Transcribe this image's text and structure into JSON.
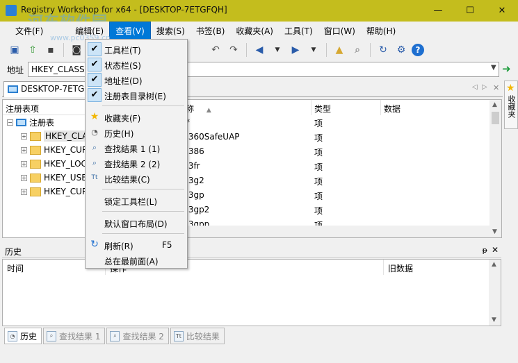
{
  "window": {
    "title": "Registry Workshop for x64 - [DESKTOP-7ETGFQH]",
    "minimize": "—",
    "maximize": "☐",
    "close": "✕",
    "watermark": "河东软件园",
    "watermark_url": "www.pc0359.cn"
  },
  "menu": [
    "文件(F)",
    "编辑(E)",
    "查看(V)",
    "搜索(S)",
    "书签(B)",
    "收藏夹(A)",
    "工具(T)",
    "窗口(W)",
    "帮助(H)"
  ],
  "address": {
    "label": "地址",
    "value": "HKEY_CLASSES_ROOT"
  },
  "main_tab": {
    "label": "DESKTOP-7ETGFQH"
  },
  "favorites_strip": {
    "label": "收藏夹"
  },
  "tree": {
    "header": "注册表项",
    "root": "注册表",
    "items": [
      "HKEY_CLA",
      "HKEY_CUR",
      "HKEY_LOC",
      "HKEY_USE",
      "HKEY_CUR"
    ]
  },
  "list": {
    "columns": [
      "称",
      "类型",
      "数据"
    ],
    "rows": [
      {
        "name": "*",
        "type": "项"
      },
      {
        "name": ".360SafeUAP",
        "type": "项"
      },
      {
        "name": ".386",
        "type": "项"
      },
      {
        "name": ".3fr",
        "type": "项"
      },
      {
        "name": ".3g2",
        "type": "项"
      },
      {
        "name": ".3gp",
        "type": "项"
      },
      {
        "name": ".3gp2",
        "type": "项"
      },
      {
        "name": ".3gpp",
        "type": "项"
      }
    ]
  },
  "history": {
    "title": "历史",
    "pin": "ᵽ",
    "close": "✕",
    "columns": [
      "时间",
      "操作",
      "旧数据"
    ]
  },
  "bottom_tabs": [
    "历史",
    "查找结果 1",
    "查找结果 2",
    "比较结果"
  ],
  "view_menu": {
    "items": [
      {
        "label": "工具栏(T)",
        "checked": true
      },
      {
        "label": "状态栏(S)",
        "checked": true
      },
      {
        "label": "地址栏(D)",
        "checked": true
      },
      {
        "label": "注册表目录树(E)",
        "checked": true
      },
      {
        "label": "收藏夹(F)",
        "icon": "star-icon"
      },
      {
        "label": "历史(H)",
        "icon": "history-icon"
      },
      {
        "label": "查找结果 1 (1)",
        "icon": "find-icon"
      },
      {
        "label": "查找结果 2 (2)",
        "icon": "find-icon"
      },
      {
        "label": "比较结果(C)",
        "icon": "compare-icon"
      },
      {
        "label": "锁定工具栏(L)"
      },
      {
        "label": "默认窗口布局(D)"
      },
      {
        "label": "刷新(R)",
        "shortcut": "F5",
        "icon": "refresh-icon"
      },
      {
        "label": "总在最前面(A)"
      }
    ]
  },
  "colors": {
    "titlebar": "#c4bd1d",
    "menu_active": "#0078d7",
    "check_bg": "#cce4f7"
  }
}
